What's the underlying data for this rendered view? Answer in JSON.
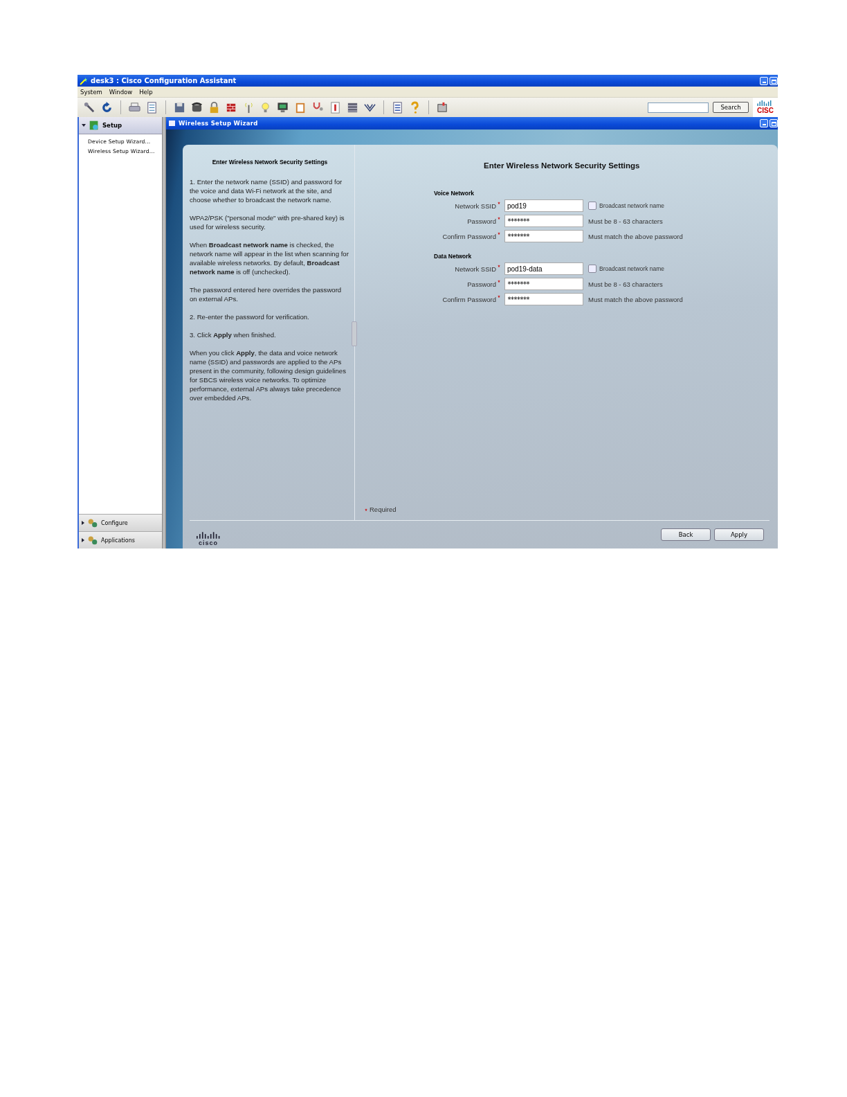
{
  "window": {
    "title": "desk3 : Cisco Configuration Assistant"
  },
  "menu": [
    "System",
    "Window",
    "Help"
  ],
  "toolbar": {
    "search_button": "Search",
    "logo": "CISC"
  },
  "sidebar": {
    "header": {
      "label": "Setup",
      "expanded": true
    },
    "items": [
      "Device Setup Wizard...",
      "Wireless Setup Wizard..."
    ],
    "sections": [
      {
        "label": "Configure",
        "expanded": false
      },
      {
        "label": "Applications",
        "expanded": false
      }
    ]
  },
  "wizard": {
    "title": "Wireless Setup Wizard",
    "help": {
      "title": "Enter Wireless Network Security Settings",
      "paragraphs": [
        "1.  Enter the network name (SSID) and password for the voice and data Wi-Fi network at the site, and choose whether to broadcast the network name.",
        "WPA2/PSK (\"personal mode\" with pre-shared key) is used for wireless security.",
        "When **Broadcast network name** is checked, the network name will appear in the list when scanning for available wireless networks. By default, **Broadcast network name** is off (unchecked).",
        "The password entered here overrides the password on external APs.",
        "2.  Re-enter the password for verification.",
        "3.  Click **Apply** when finished.",
        "When you click **Apply**, the data and voice network name (SSID) and passwords are applied to the APs present in the community, following design guidelines for SBCS wireless voice networks. To optimize performance, external APs always take precedence over embedded APs."
      ]
    },
    "heading": "Enter Wireless Network Security Settings",
    "networks": [
      {
        "title": "Voice Network",
        "fields": [
          {
            "kind": "checkbox",
            "label": "Network SSID",
            "required": true,
            "value": "pod19",
            "note": "Broadcast network name",
            "checked": false
          },
          {
            "kind": "hint",
            "label": "Password",
            "required": true,
            "value": "*******",
            "note": "Must be 8 - 63 characters"
          },
          {
            "kind": "hint",
            "label": "Confirm Password",
            "required": true,
            "value": "*******",
            "note": "Must match the above password"
          }
        ]
      },
      {
        "title": "Data Network",
        "fields": [
          {
            "kind": "checkbox",
            "label": "Network SSID",
            "required": true,
            "value": "pod19-data",
            "note": "Broadcast network name",
            "checked": false
          },
          {
            "kind": "hint",
            "label": "Password",
            "required": true,
            "value": "*******",
            "note": "Must be 8 - 63 characters"
          },
          {
            "kind": "hint",
            "label": "Confirm Password",
            "required": true,
            "value": "*******",
            "note": "Must match the above password"
          }
        ]
      }
    ],
    "required_note": "Required",
    "logo": "cisco",
    "buttons": [
      "Back",
      "Apply"
    ]
  }
}
